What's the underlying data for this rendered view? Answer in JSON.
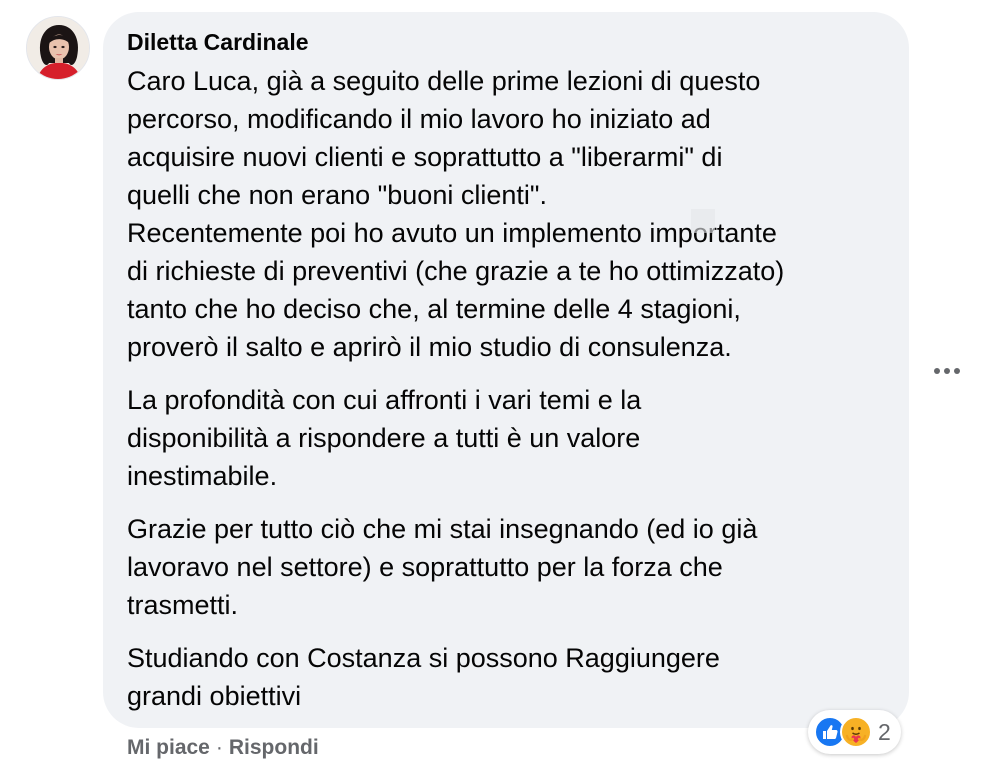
{
  "comment": {
    "author": "Diletta Cardinale",
    "paragraphs": [
      {
        "lines": [
          "Caro Luca, già a seguito delle prime lezioni di questo",
          "percorso, modificando il mio lavoro ho iniziato ad",
          "acquisire nuovi clienti e soprattutto a \"liberarmi\" di",
          "quelli che non erano \"buoni clienti\".",
          "Recentemente poi ho avuto un implemento importante",
          "di richieste di preventivi (che grazie a te ho ottimizzato)",
          "tanto che ho deciso che, al termine delle 4 stagioni,",
          "proverò il salto e aprirò il mio studio di consulenza."
        ]
      },
      {
        "lines": [
          "La profondità con cui affronti i vari temi e la",
          "disponibilità a rispondere a tutti è un valore",
          "inestimabile."
        ]
      },
      {
        "lines": [
          "Grazie per tutto ciò che mi stai insegnando (ed io già",
          "lavoravo nel settore) e soprattutto per la forza che",
          "trasmetti."
        ]
      },
      {
        "lines": [
          "Studiando con Costanza si possono Raggiungere",
          "grandi obiettivi"
        ]
      }
    ]
  },
  "actions": {
    "like_label": "Mi piace",
    "separator": "·",
    "reply_label": "Rispondi"
  },
  "reactions": {
    "icons": [
      "like-icon",
      "care-icon"
    ],
    "count": "2"
  },
  "colors": {
    "bubble_bg": "#f0f2f5",
    "text": "#050505",
    "secondary_text": "#65676b",
    "like_blue": "#1877f2",
    "care_yellow": "#f7b125"
  }
}
